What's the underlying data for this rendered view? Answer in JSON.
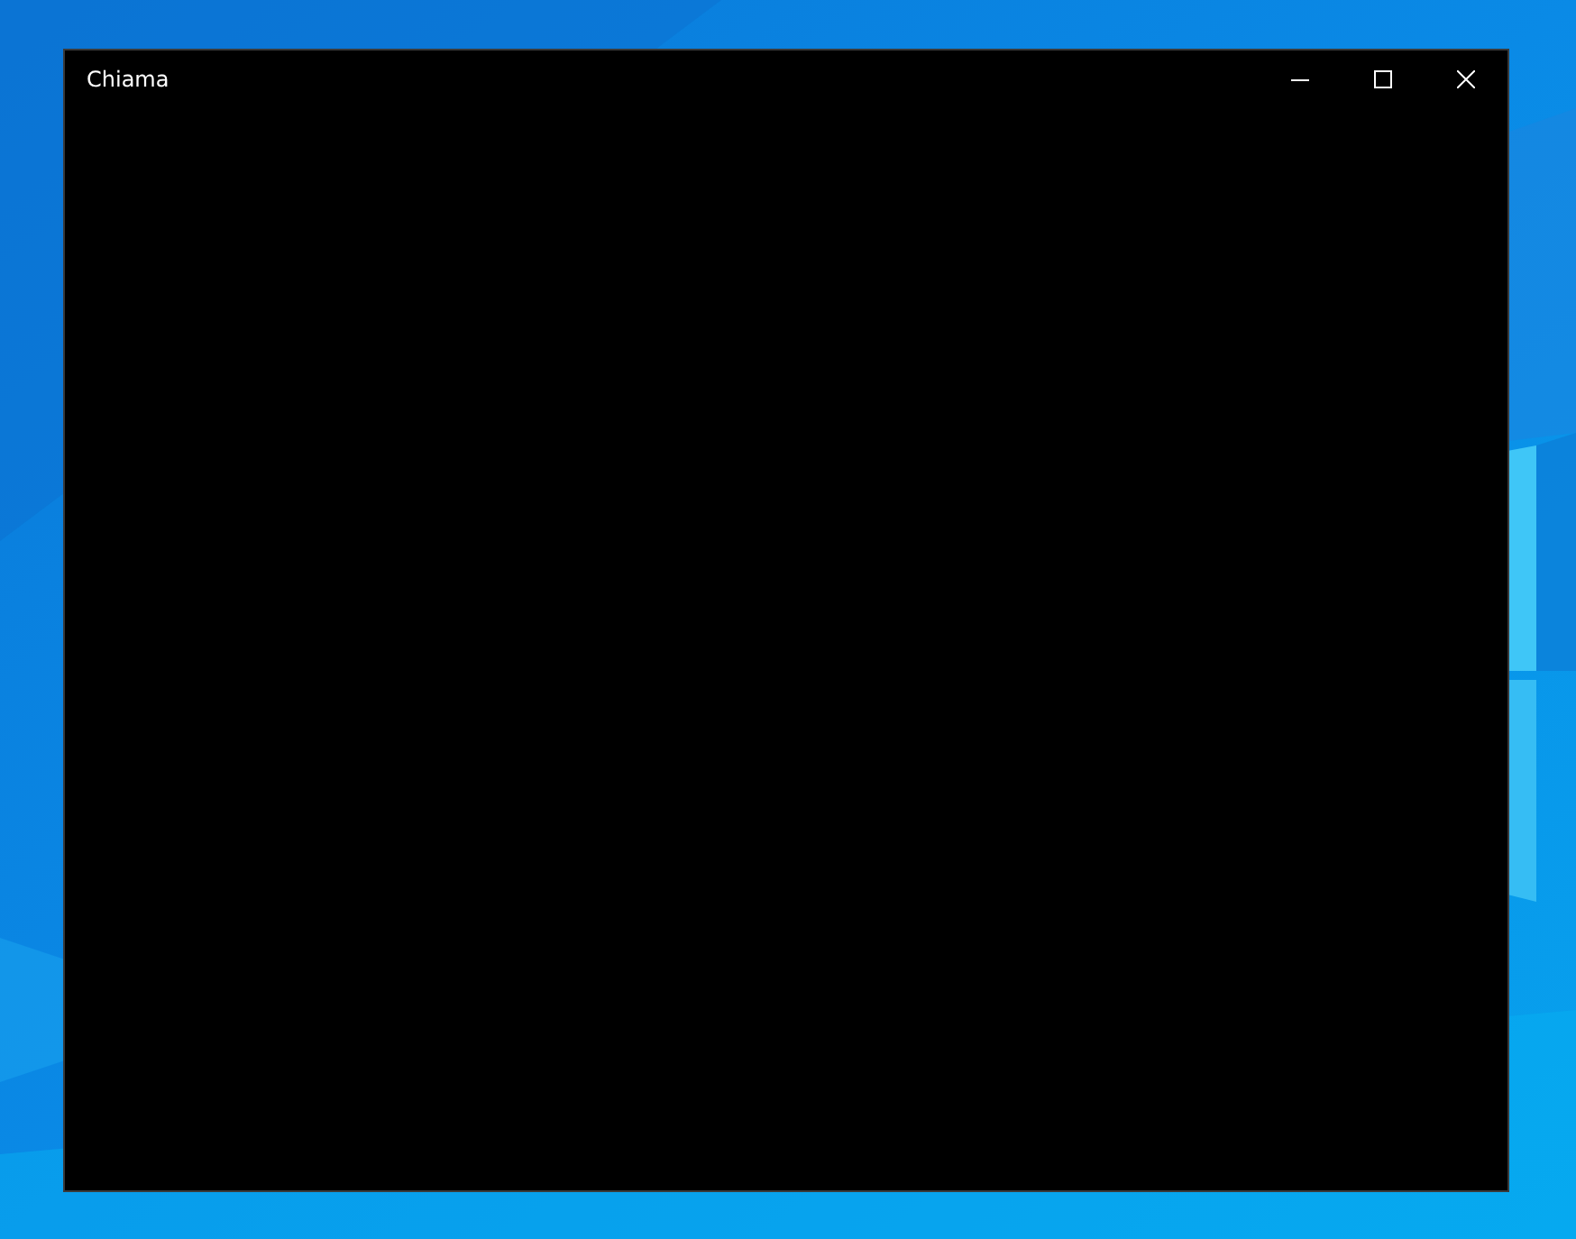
{
  "window": {
    "title": "Chiama"
  }
}
